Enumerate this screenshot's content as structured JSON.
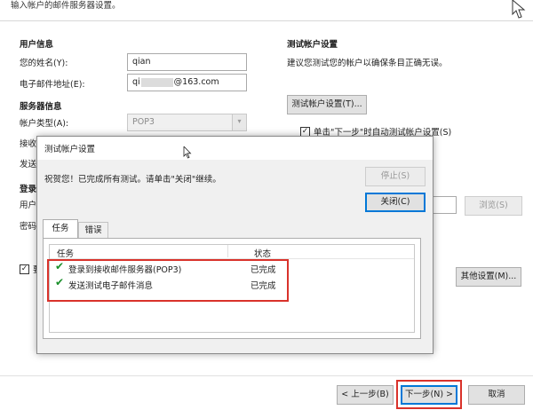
{
  "wizard": {
    "header_text": "输入帐户的邮件服务器设置。",
    "user_info": {
      "title": "用户信息",
      "name_label": "您的姓名(Y):",
      "name_value": "qian",
      "email_label": "电子邮件地址(E):",
      "email_prefix": "qi",
      "email_suffix": "@163.com"
    },
    "server_info": {
      "title": "服务器信息",
      "account_type_label": "帐户类型(A):",
      "account_type_value": "POP3",
      "incoming_label_partial": "接收",
      "outgoing_label_partial": "发送"
    },
    "login_info": {
      "title_partial": "登录",
      "user_label_partial": "用户",
      "password_label_partial": "密码",
      "remember_label_partial": "要"
    },
    "test_settings": {
      "title": "测试帐户设置",
      "description": "建议您测试您的帐户以确保条目正确无误。",
      "test_button": "测试帐户设置(T)...",
      "auto_test_label": "单击\"下一步\"时自动测试帐户设置(S)"
    },
    "browse_button": "浏览(S)",
    "more_settings_button": "其他设置(M)...",
    "back_button": "< 上一步(B)",
    "next_button": "下一步(N) >",
    "cancel_button": "取消"
  },
  "dialog": {
    "title": "测试帐户设置",
    "message": "祝贺您！已完成所有测试。请单击\"关闭\"继续。",
    "stop_button": "停止(S)",
    "close_button": "关闭(C)",
    "tabs": [
      "任务",
      "错误"
    ],
    "columns": [
      "任务",
      "状态"
    ],
    "tasks": [
      {
        "name": "登录到接收邮件服务器(POP3)",
        "status": "已完成"
      },
      {
        "name": "发送测试电子邮件消息",
        "status": "已完成"
      }
    ]
  },
  "colors": {
    "highlight_red": "#d9322b",
    "check_green": "#1a8f2a",
    "focus_blue": "#0078d7"
  }
}
